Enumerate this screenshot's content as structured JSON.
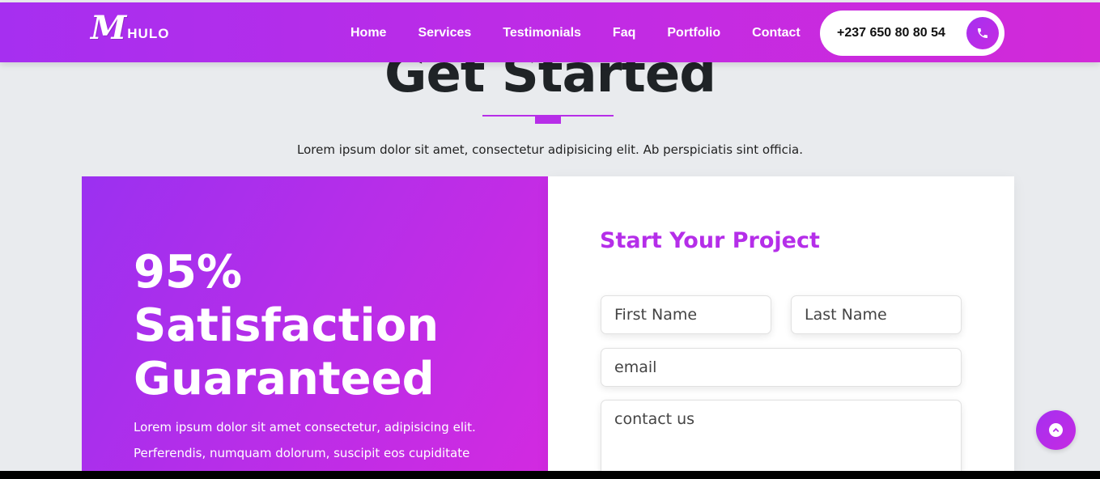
{
  "nav": {
    "logo_mark": "M",
    "logo_text": "HULO",
    "links": [
      "Home",
      "Services",
      "Testimonials",
      "Faq",
      "Portfolio",
      "Contact"
    ],
    "phone": "+237 650 80 80 54"
  },
  "section": {
    "title": "Get Started",
    "subtitle": "Lorem ipsum dolor sit amet, consectetur adipisicing elit. Ab perspiciatis sint officia."
  },
  "promo": {
    "heading_lines": [
      "95%",
      "Satisfaction",
      "Guaranteed"
    ],
    "text_lines": [
      "Lorem ipsum dolor sit amet consectetur, adipisicing elit.",
      "Perferendis, numquam dolorum, suscipit eos cupiditate"
    ]
  },
  "form": {
    "title": "Start Your Project",
    "first_name_placeholder": "First Name",
    "last_name_placeholder": "Last Name",
    "email_placeholder": "email",
    "message_placeholder": "contact us"
  },
  "colors": {
    "brand_purple": "#a62ff0",
    "brand_magenta": "#d22ad8",
    "background": "#e9ebee"
  },
  "icons": {
    "phone": "phone-icon",
    "scroll_top": "chevron-up-icon"
  }
}
